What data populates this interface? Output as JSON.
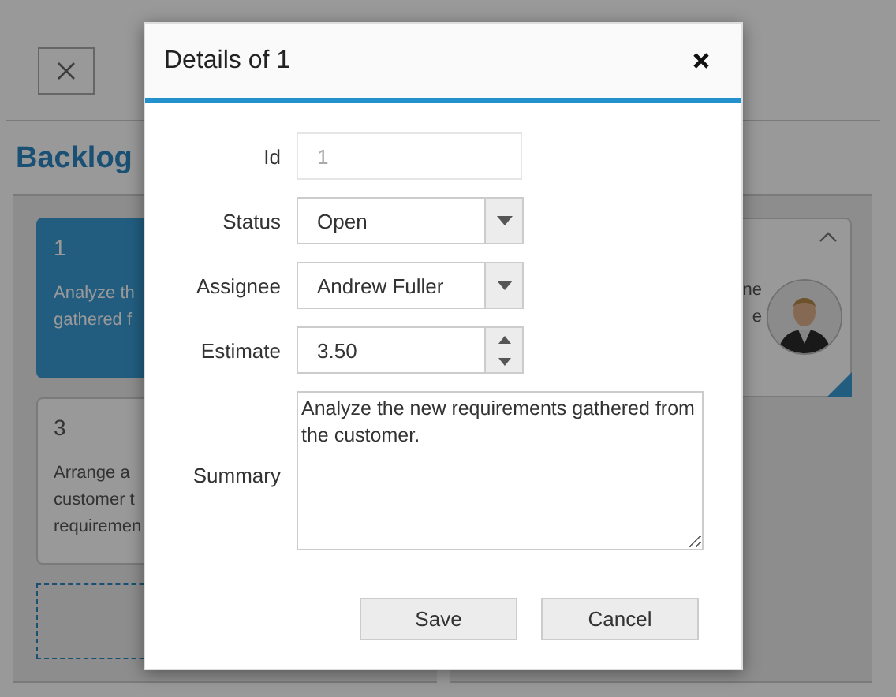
{
  "board": {
    "column_title": "Backlog",
    "cards": [
      {
        "id": "1",
        "lines": [
          "Analyze th",
          "gathered f"
        ],
        "selected": true
      },
      {
        "id": "3",
        "lines": [
          "Arrange a",
          "customer t",
          "requiremen"
        ],
        "selected": false
      }
    ],
    "right_card": {
      "lines": [
        "ne",
        "e"
      ],
      "avatar": {
        "kind": "picture"
      }
    }
  },
  "dialog": {
    "title": "Details of 1",
    "fields": [
      {
        "kind": "readonly",
        "label": "Id",
        "value": "1",
        "disabled": true
      },
      {
        "kind": "dropdown",
        "label": "Status",
        "value": "Open"
      },
      {
        "kind": "dropdown",
        "label": "Assignee",
        "value": "Andrew Fuller"
      },
      {
        "kind": "numeric",
        "label": "Estimate",
        "value": "3.50"
      },
      {
        "kind": "textarea",
        "label": "Summary",
        "value": "Analyze the new requirements gathered from the customer."
      }
    ],
    "buttons": [
      "Save",
      "Cancel"
    ]
  }
}
